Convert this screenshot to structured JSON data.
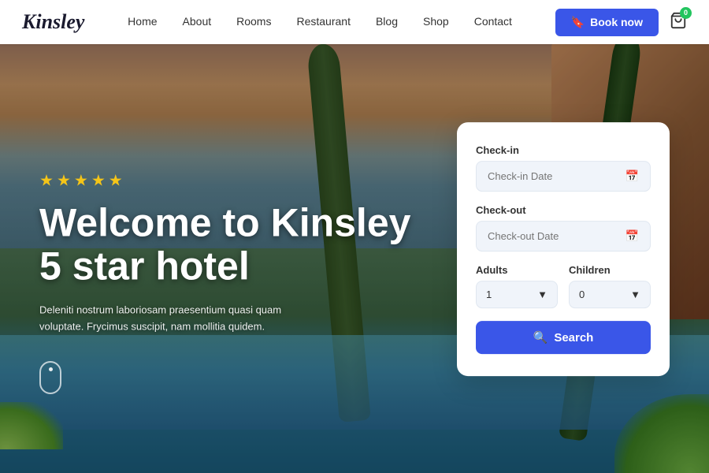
{
  "brand": {
    "logo": "Kinsley"
  },
  "navbar": {
    "links": [
      {
        "id": "home",
        "label": "Home"
      },
      {
        "id": "about",
        "label": "About"
      },
      {
        "id": "rooms",
        "label": "Rooms"
      },
      {
        "id": "restaurant",
        "label": "Restaurant"
      },
      {
        "id": "blog",
        "label": "Blog"
      },
      {
        "id": "shop",
        "label": "Shop"
      },
      {
        "id": "contact",
        "label": "Contact"
      }
    ],
    "book_now": "Book now",
    "cart_count": "0"
  },
  "hero": {
    "stars_count": 5,
    "title_line1": "Welcome to Kinsley",
    "title_line2": "5 star hotel",
    "subtitle": "Deleniti nostrum laboriosam praesentium quasi quam voluptate. Frycimus suscipit, nam mollitia quidem."
  },
  "booking": {
    "checkin_label": "Check-in",
    "checkin_placeholder": "Check-in Date",
    "checkout_label": "Check-out",
    "checkout_placeholder": "Check-out Date",
    "adults_label": "Adults",
    "adults_value": "1",
    "children_label": "Children",
    "children_value": "0",
    "search_btn": "Search"
  }
}
